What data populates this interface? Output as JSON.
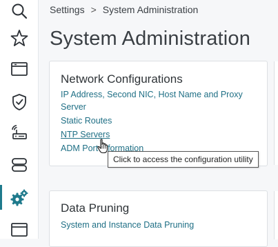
{
  "breadcrumb": {
    "root": "Settings",
    "separator": ">",
    "current": "System Administration"
  },
  "page_title": "System Administration",
  "cards": {
    "network": {
      "title": "Network Configurations",
      "links": [
        "IP Address, Second NIC, Host Name and Proxy",
        "Server",
        "Static Routes",
        "NTP Servers",
        "ADM Port Information"
      ]
    },
    "pruning": {
      "title": "Data Pruning",
      "links": [
        "System and Instance Data Pruning"
      ]
    }
  },
  "tooltip": "Click to access the configuration utility",
  "nav_icons": [
    "search-icon",
    "star-icon",
    "browser-icon",
    "shield-icon",
    "network-device-icon",
    "database-icon",
    "gears-icon",
    "window-icon"
  ],
  "colors": {
    "accent": "#1f7a8c",
    "link": "#1f6f85",
    "text": "#3a3f44"
  }
}
